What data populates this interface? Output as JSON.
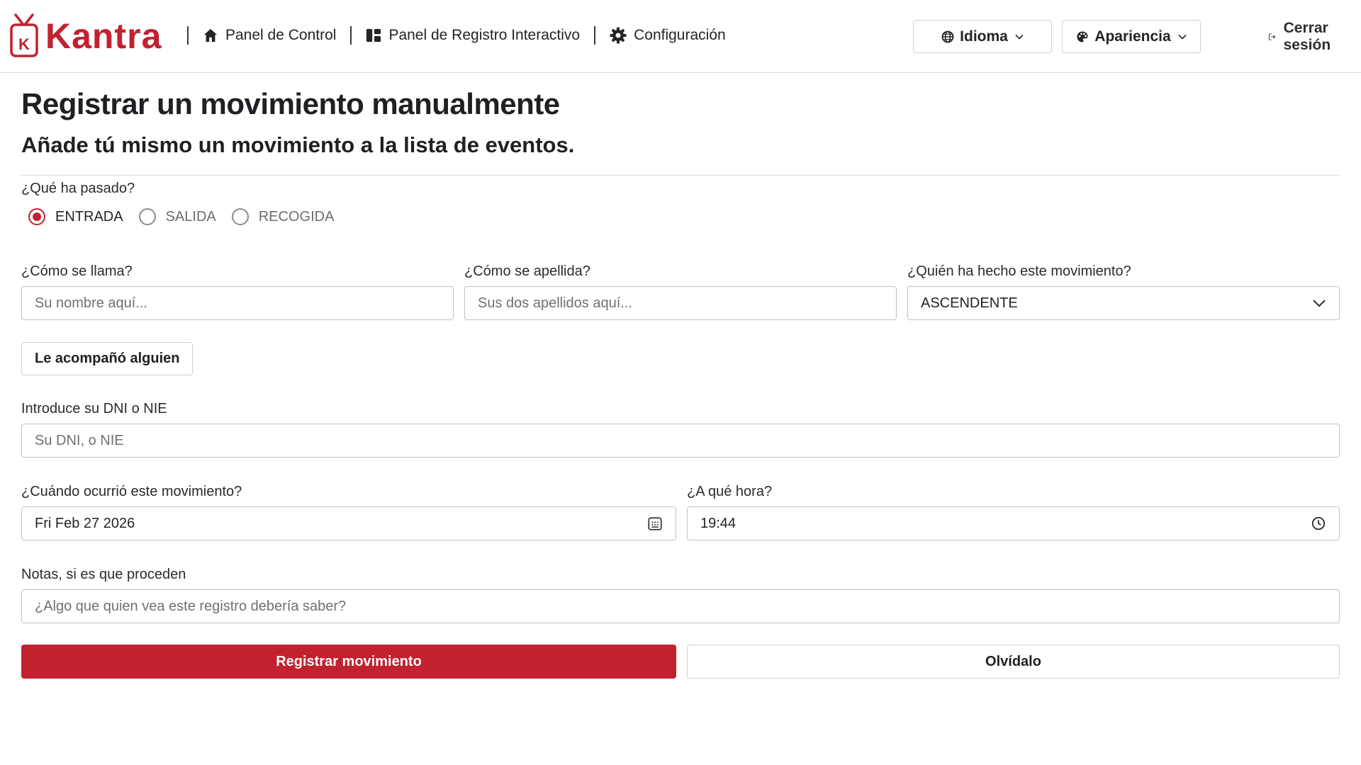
{
  "brand": {
    "name": "Kantra",
    "logo_icon": "tv-logo-icon",
    "accent_color": "#c2212f"
  },
  "nav": {
    "items": [
      {
        "label": "Panel de Control",
        "icon": "home-icon"
      },
      {
        "label": "Panel de Registro Interactivo",
        "icon": "dashboard-icon"
      },
      {
        "label": "Configuración",
        "icon": "gear-icon"
      }
    ]
  },
  "header_actions": {
    "language": {
      "label": "Idioma",
      "icon": "globe-icon"
    },
    "appearance": {
      "label": "Apariencia",
      "icon": "palette-icon"
    },
    "logout": {
      "label": "Cerrar sesión",
      "icon": "logout-icon"
    }
  },
  "page": {
    "title": "Registrar un movimiento manualmente",
    "subtitle": "Añade tú mismo un movimiento a la lista de eventos."
  },
  "form": {
    "event_type": {
      "label": "¿Qué ha pasado?",
      "options": [
        "ENTRADA",
        "SALIDA",
        "RECOGIDA"
      ],
      "selected": "ENTRADA"
    },
    "first_name": {
      "label": "¿Cómo se llama?",
      "placeholder": "Su nombre aquí...",
      "value": ""
    },
    "last_name": {
      "label": "¿Cómo se apellida?",
      "placeholder": "Sus dos apellidos aquí...",
      "value": ""
    },
    "actor": {
      "label": "¿Quién ha hecho este movimiento?",
      "value": "ASCENDENTE"
    },
    "companion_button": "Le acompañó alguien",
    "document": {
      "label": "Introduce su DNI o NIE",
      "placeholder": "Su DNI, o NIE",
      "value": ""
    },
    "date": {
      "label": "¿Cuándo ocurrió este movimiento?",
      "value": "Fri Feb 27 2026"
    },
    "time": {
      "label": "¿A qué hora?",
      "value": "19:44"
    },
    "notes": {
      "label": "Notas, si es que proceden",
      "placeholder": "¿Algo que quien vea este registro debería saber?",
      "value": ""
    },
    "submit_label": "Registrar movimiento",
    "cancel_label": "Olvídalo"
  }
}
